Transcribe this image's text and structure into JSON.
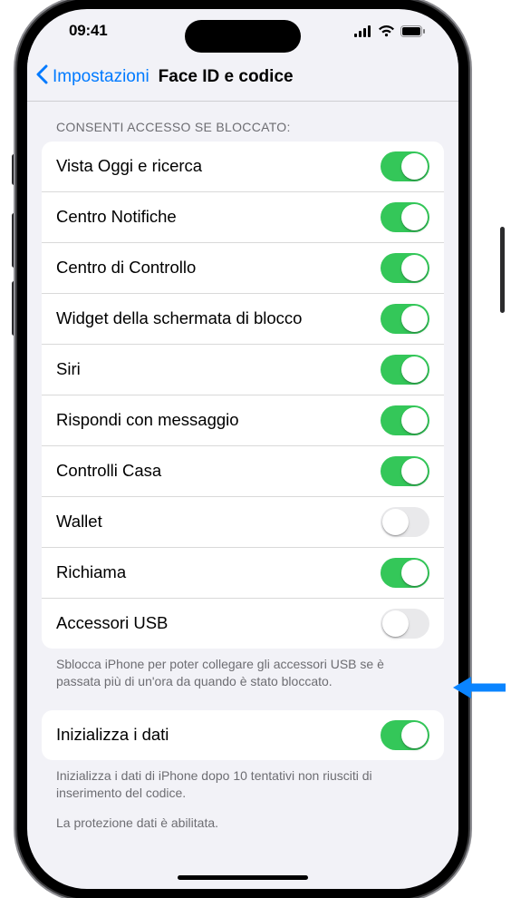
{
  "status": {
    "time": "09:41"
  },
  "nav": {
    "back_label": "Impostazioni",
    "title": "Face ID e codice"
  },
  "section1": {
    "header": "CONSENTI ACCESSO SE BLOCCATO:",
    "rows": [
      {
        "label": "Vista Oggi e ricerca",
        "on": true
      },
      {
        "label": "Centro Notifiche",
        "on": true
      },
      {
        "label": "Centro di Controllo",
        "on": true
      },
      {
        "label": "Widget della schermata di blocco",
        "on": true
      },
      {
        "label": "Siri",
        "on": true
      },
      {
        "label": "Rispondi con messaggio",
        "on": true
      },
      {
        "label": "Controlli Casa",
        "on": true
      },
      {
        "label": "Wallet",
        "on": false
      },
      {
        "label": "Richiama",
        "on": true
      },
      {
        "label": "Accessori USB",
        "on": false
      }
    ],
    "footer": "Sblocca iPhone per poter collegare gli accessori USB se è passata più di un'ora da quando è stato bloccato."
  },
  "section2": {
    "row": {
      "label": "Inizializza i dati",
      "on": true
    },
    "footer1": "Inizializza i dati di iPhone dopo 10 tentativi non riusciti di inserimento del codice.",
    "footer2": "La protezione dati è abilitata."
  }
}
